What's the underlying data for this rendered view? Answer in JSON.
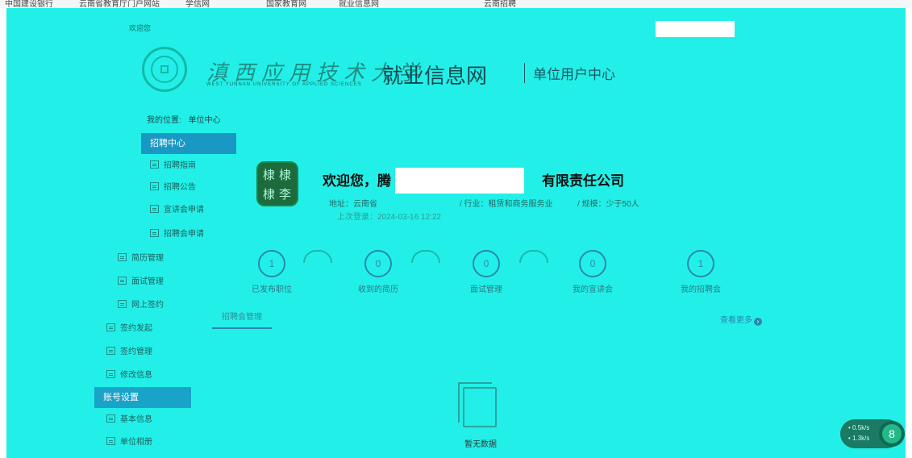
{
  "colors": {
    "page_bg": "#22f0e8",
    "nav_category_active": "#1a98c4",
    "nav_category_teal": "#1aa3c9",
    "stat_accent": "#2a87b2",
    "white": "#ffffff"
  },
  "bookmarks": [
    "中国建设银行",
    "云南省教育厅门户网站",
    "学信网",
    "国家教育网",
    "就业信息网",
    "云南招聘"
  ],
  "topbar": {
    "welcome": "欢迎您"
  },
  "header": {
    "univ_name_cn": "滇西应用技术大学",
    "univ_name_en": "WEST YUNNAN UNIVERSITY OF APPLIED SCIENCES",
    "site_title": "就业信息网",
    "user_center": "单位用户中心"
  },
  "breadcrumb": {
    "label": "我的位置:",
    "current": "单位中心"
  },
  "sidebar": {
    "category1": "招聘中心",
    "items1": [
      "招聘指南",
      "招聘公告",
      "宣讲会申请",
      "招聘会申请",
      "简历管理",
      "面试管理",
      "网上签约"
    ],
    "items2": [
      "签约发起",
      "签约管理",
      "修改信息"
    ],
    "category2": "账号设置",
    "items3": [
      "基本信息",
      "单位相册"
    ]
  },
  "company": {
    "logo_chars": [
      "棣",
      "棣",
      "棣",
      "李"
    ],
    "welcome_prefix": "欢迎您，腾",
    "name_suffix": "有限责任公司",
    "address": "地址：云南省",
    "industry": "/ 行业：租赁和商务服务业",
    "scale": "/ 规模：少于50人",
    "last_login": "上次登录：2024-03-16 12:22"
  },
  "stats": [
    {
      "count": "1",
      "label": "已发布职位"
    },
    {
      "count": "0",
      "label": "收到的简历"
    },
    {
      "count": "0",
      "label": "面试管理"
    },
    {
      "count": "0",
      "label": "我的宣讲会"
    },
    {
      "count": "1",
      "label": "我的招聘会"
    }
  ],
  "tabs": {
    "active": "招聘会管理",
    "see_more": "查看更多"
  },
  "empty": {
    "text": "暂无数据"
  },
  "speed": {
    "up": "• 0.5k/s",
    "down": "• 1.3k/s",
    "ring_label": "8"
  }
}
